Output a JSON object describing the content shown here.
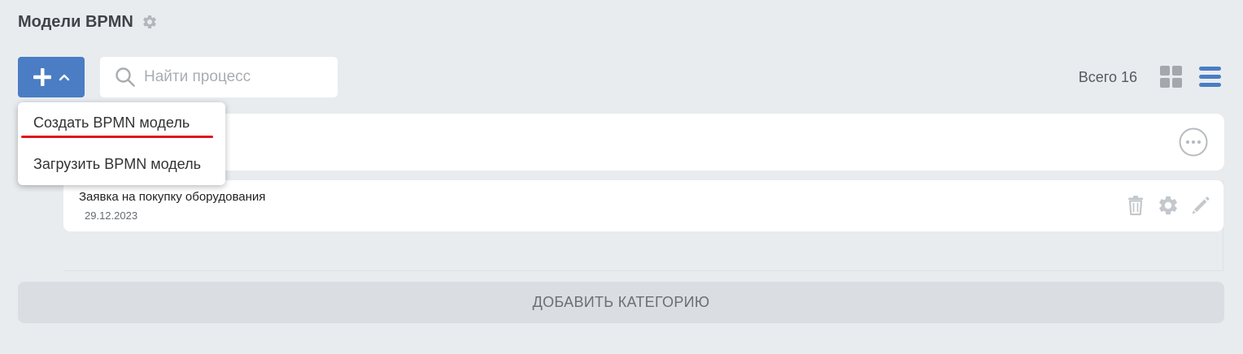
{
  "header": {
    "title": "Модели BPMN",
    "settings_icon": "gear-icon"
  },
  "toolbar": {
    "add_button_icons": [
      "plus-icon",
      "chevron-up-icon"
    ],
    "search": {
      "placeholder": "Найти процесс",
      "value": ""
    },
    "total_label": "Всего 16",
    "view_modes": [
      "grid-view-icon",
      "list-view-icon"
    ]
  },
  "add_menu": {
    "items": [
      {
        "label": "Создать BPMN модель",
        "highlighted": true
      },
      {
        "label": "Загрузить BPMN модель",
        "highlighted": false
      }
    ],
    "highlight_color": "#e0151b"
  },
  "category": {
    "more_icon": "more-horizontal-icon",
    "processes": [
      {
        "name": "Заявка на покупку оборудования",
        "date": "29.12.2023",
        "actions": [
          "trash-icon",
          "gear-icon",
          "pencil-icon"
        ]
      }
    ]
  },
  "footer": {
    "add_category_label": "ДОБАВИТЬ КАТЕГОРИЮ"
  },
  "colors": {
    "accent": "#4a7dc4",
    "background": "#e8ecef",
    "card": "#ffffff"
  }
}
